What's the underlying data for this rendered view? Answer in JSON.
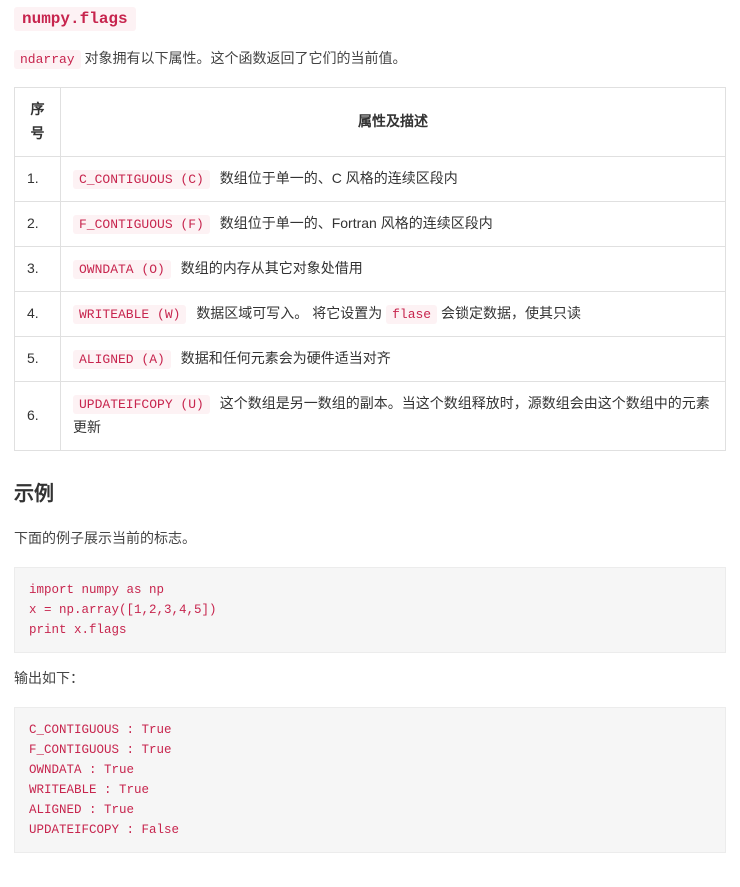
{
  "title_code": "numpy.flags",
  "intro": {
    "code": "ndarray",
    "after": "对象拥有以下属性。这个函数返回了它们的当前值。"
  },
  "table": {
    "headers": [
      "序号",
      "属性及描述"
    ],
    "rows": [
      {
        "n": "1.",
        "code": "C_CONTIGUOUS (C)",
        "after": "数组位于单一的、C 风格的连续区段内"
      },
      {
        "n": "2.",
        "code": "F_CONTIGUOUS (F)",
        "after": "数组位于单一的、Fortran 风格的连续区段内"
      },
      {
        "n": "3.",
        "code": "OWNDATA (O)",
        "after": "数组的内存从其它对象处借用"
      },
      {
        "n": "4.",
        "code": "WRITEABLE (W)",
        "after": "数据区域可写入。 将它设置为 ",
        "code2": "flase",
        "after2": " 会锁定数据，使其只读"
      },
      {
        "n": "5.",
        "code": "ALIGNED (A)",
        "after": "数据和任何元素会为硬件适当对齐"
      },
      {
        "n": "6.",
        "code": "UPDATEIFCOPY (U)",
        "after": "这个数组是另一数组的副本。当这个数组释放时，源数组会由这个数组中的元素更新"
      }
    ]
  },
  "example_heading": "示例",
  "example_intro": "下面的例子展示当前的标志。",
  "code_block": "import numpy as np\nx = np.array([1,2,3,4,5])\nprint x.flags",
  "output_label": "输出如下：",
  "output_block": "C_CONTIGUOUS : True\nF_CONTIGUOUS : True\nOWNDATA : True\nWRITEABLE : True\nALIGNED : True\nUPDATEIFCOPY : False"
}
